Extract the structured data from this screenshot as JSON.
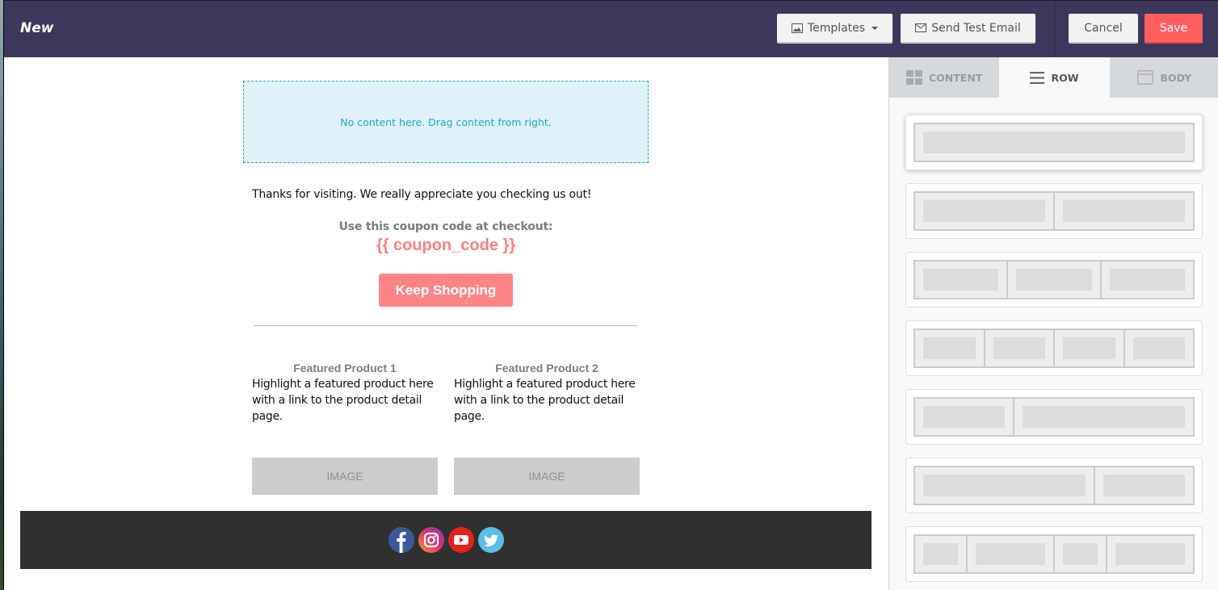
{
  "header": {
    "title": "New",
    "buttons": {
      "templates": "Templates",
      "send_test": "Send Test Email",
      "cancel": "Cancel",
      "save": "Save"
    },
    "colors": {
      "bar": "#3e375c",
      "save": "#ff5f5f"
    }
  },
  "canvas": {
    "dropzone_text": "No content here. Drag content from right.",
    "thanks_text": "Thanks for visiting. We really appreciate you checking us out!",
    "coupon_label": "Use this coupon code at checkout:",
    "coupon_code": "{{ coupon_code }}",
    "cta_button": "Keep Shopping",
    "products": [
      {
        "title": "Featured Product 1",
        "description": "Highlight a featured product here with a link to the product detail page.",
        "image_label": "IMAGE"
      },
      {
        "title": "Featured Product 2",
        "description": "Highlight a featured product here with a link to the product detail page.",
        "image_label": "IMAGE"
      }
    ],
    "footer_social": [
      "facebook-icon",
      "instagram-icon",
      "youtube-icon",
      "twitter-icon"
    ]
  },
  "sidebar": {
    "tabs": [
      {
        "label": "CONTENT",
        "icon": "grid-icon",
        "active": false
      },
      {
        "label": "ROW",
        "icon": "menu-lines-icon",
        "active": true
      },
      {
        "label": "BODY",
        "icon": "window-icon",
        "active": false
      }
    ],
    "row_layouts": [
      {
        "columns": [
          1
        ],
        "selected": true
      },
      {
        "columns": [
          1,
          1
        ]
      },
      {
        "columns": [
          1,
          1,
          1
        ]
      },
      {
        "columns": [
          1,
          1,
          1,
          1
        ]
      },
      {
        "columns": [
          1,
          2
        ]
      },
      {
        "columns": [
          2,
          1
        ]
      },
      {
        "columns": [
          1,
          2,
          1,
          2
        ]
      }
    ]
  }
}
